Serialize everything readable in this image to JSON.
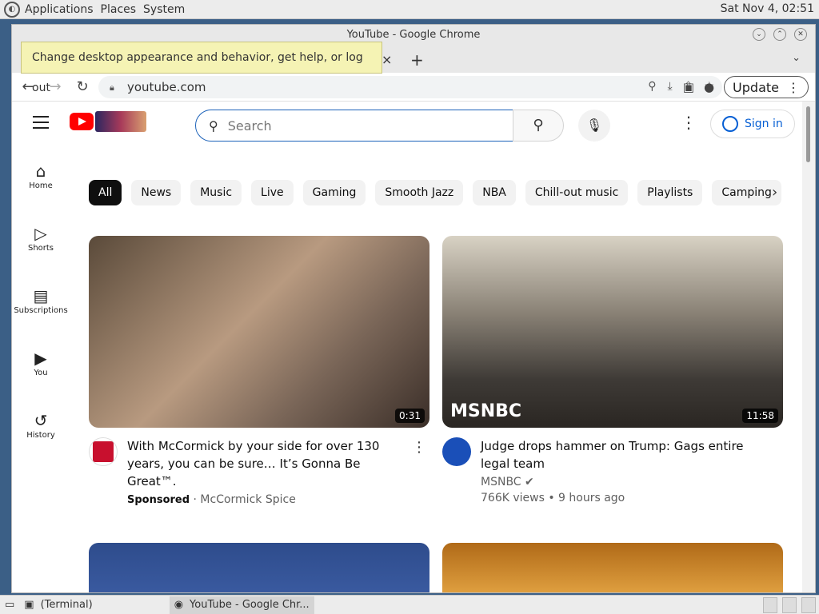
{
  "top_panel": {
    "menus": [
      "Applications",
      "Places",
      "System"
    ],
    "clock": "Sat Nov  4, 02:51"
  },
  "window": {
    "title": "YouTube - Google Chrome"
  },
  "tooltip": "Change desktop appearance and behavior, get help, or log out",
  "browser": {
    "tab_close": "×",
    "new_tab": "+",
    "url": "youtube.com",
    "update_label": "Update"
  },
  "youtube": {
    "search_placeholder": "Search",
    "signin_label": "Sign in",
    "sidebar": [
      {
        "label": "Home",
        "icon": "home-icon"
      },
      {
        "label": "Shorts",
        "icon": "shorts-icon"
      },
      {
        "label": "Subscriptions",
        "icon": "subscriptions-icon"
      },
      {
        "label": "You",
        "icon": "you-icon"
      },
      {
        "label": "History",
        "icon": "history-icon"
      }
    ],
    "chips": [
      "All",
      "News",
      "Music",
      "Live",
      "Gaming",
      "Smooth Jazz",
      "NBA",
      "Chill-out music",
      "Playlists",
      "Camping"
    ],
    "videos": [
      {
        "title": "With McCormick by your side for over 130 years, you can be sure… It’s Gonna Be Great™.",
        "sponsored": "Sponsored",
        "channel": "McCormick Spice",
        "duration": "0:31"
      },
      {
        "title": "Judge drops hammer on Trump: Gags entire legal team",
        "channel": "MSNBC",
        "stats": "766K views • 9 hours ago",
        "duration": "11:58",
        "thumb_brand": "MSNBC"
      }
    ]
  },
  "taskbar": {
    "items": [
      "(Terminal)",
      "YouTube - Google Chr..."
    ]
  },
  "colors": {
    "youtube_red": "#ff0000",
    "link_blue": "#065fd4",
    "tooltip_bg": "#f5f3b4"
  }
}
